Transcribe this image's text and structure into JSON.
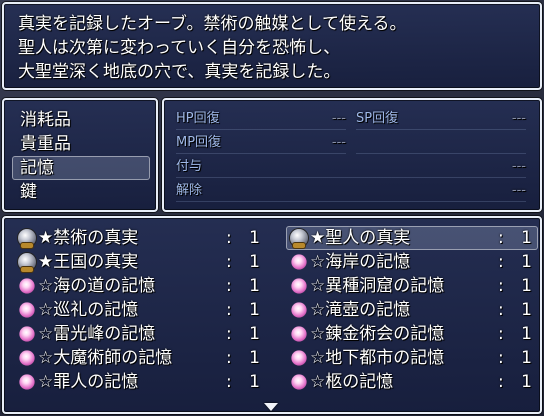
{
  "help": {
    "lines": [
      "真実を記録したオーブ。禁術の触媒として使える。",
      "聖人は次第に変わっていく自分を恐怖し、",
      "大聖堂深く地底の穴で、真実を記録した。"
    ]
  },
  "categories": [
    {
      "label": "消耗品",
      "selected": false
    },
    {
      "label": "貴重品",
      "selected": false
    },
    {
      "label": "記憶",
      "selected": true
    },
    {
      "label": "鍵",
      "selected": false
    }
  ],
  "stats": [
    {
      "label": "HP回復",
      "value": "---"
    },
    {
      "label": "SP回復",
      "value": "---"
    },
    {
      "label": "MP回復",
      "value": "---"
    },
    {
      "label": "付与",
      "value": "---"
    },
    {
      "label": "解除",
      "value": "---"
    }
  ],
  "items": [
    {
      "name": "★禁術の真実",
      "count": "1",
      "icon": "orb-icon",
      "selected": false
    },
    {
      "name": "★聖人の真実",
      "count": "1",
      "icon": "orb-icon",
      "selected": true
    },
    {
      "name": "★王国の真実",
      "count": "1",
      "icon": "orb-icon",
      "selected": false
    },
    {
      "name": "☆海岸の記憶",
      "count": "1",
      "icon": "memory-icon",
      "selected": false
    },
    {
      "name": "☆海の道の記憶",
      "count": "1",
      "icon": "memory-icon",
      "selected": false
    },
    {
      "name": "☆異種洞窟の記憶",
      "count": "1",
      "icon": "memory-icon",
      "selected": false
    },
    {
      "name": "☆巡礼の記憶",
      "count": "1",
      "icon": "memory-icon",
      "selected": false
    },
    {
      "name": "☆滝壺の記憶",
      "count": "1",
      "icon": "memory-icon",
      "selected": false
    },
    {
      "name": "☆雷光峰の記憶",
      "count": "1",
      "icon": "memory-icon",
      "selected": false
    },
    {
      "name": "☆錬金術会の記憶",
      "count": "1",
      "icon": "memory-icon",
      "selected": false
    },
    {
      "name": "☆大魔術師の記憶",
      "count": "1",
      "icon": "memory-icon",
      "selected": false
    },
    {
      "name": "☆地下都市の記憶",
      "count": "1",
      "icon": "memory-icon",
      "selected": false
    },
    {
      "name": "☆罪人の記憶",
      "count": "1",
      "icon": "memory-icon",
      "selected": false
    },
    {
      "name": "☆柩の記憶",
      "count": "1",
      "icon": "memory-icon",
      "selected": false
    }
  ],
  "separator": ":",
  "colors": {
    "window_border": "#e8eef8",
    "stat_label": "#9fb8e8",
    "stat_value": "#8890a8"
  }
}
